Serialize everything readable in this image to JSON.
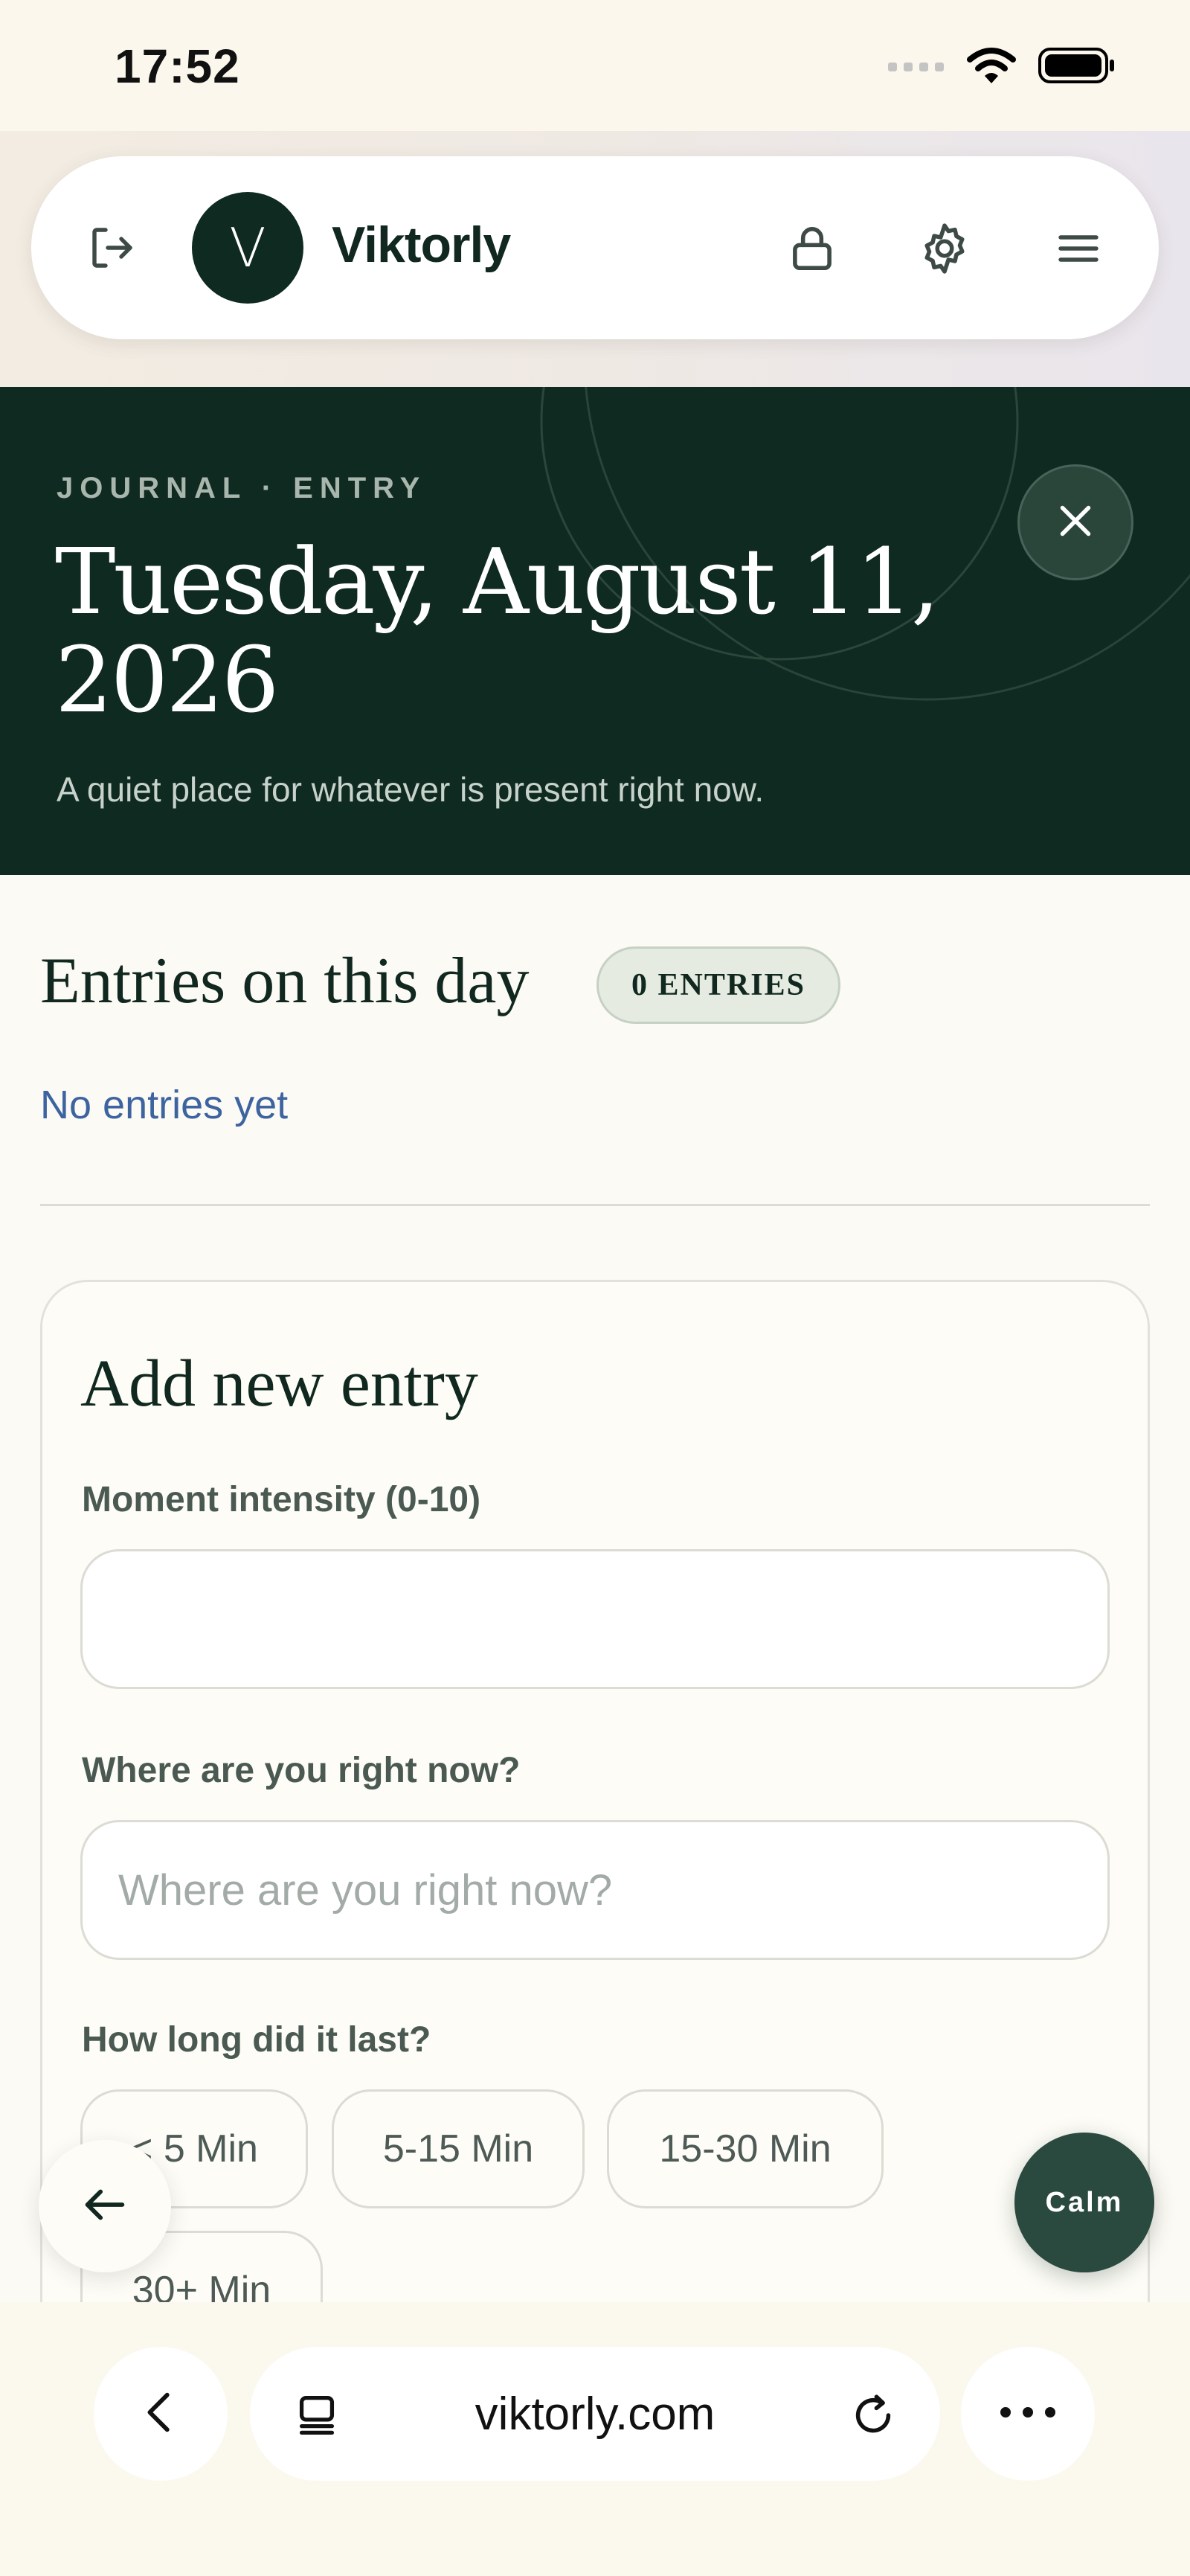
{
  "status_bar": {
    "time": "17:52",
    "icons": [
      "signal-icon",
      "wifi-icon",
      "battery-icon"
    ]
  },
  "nav": {
    "brand": "Viktorly",
    "logo_letter": "V",
    "icons": [
      "logout-icon",
      "lock-icon",
      "gear-icon",
      "menu-icon"
    ]
  },
  "hero": {
    "kicker": "JOURNAL · ENTRY",
    "title": "Tuesday, August 11, 2026",
    "subtitle": "A quiet place for whatever is present right now.",
    "close_icon": "close-icon"
  },
  "entries": {
    "heading": "Entries on this day",
    "count_badge": "0 ENTRIES",
    "empty_text": "No entries yet"
  },
  "form": {
    "title": "Add new entry",
    "intensity": {
      "label": "Moment intensity (0-10)",
      "value": "",
      "placeholder": ""
    },
    "location": {
      "label": "Where are you right now?",
      "value": "",
      "placeholder": "Where are you right now?"
    },
    "duration": {
      "label": "How long did it last?",
      "options": [
        "< 5 Min",
        "5-15 Min",
        "15-30 Min",
        "30+ Min"
      ]
    }
  },
  "floating": {
    "back_icon": "arrow-left-icon",
    "calm_label": "Calm"
  },
  "browser": {
    "url": "viktorly.com",
    "icons": [
      "chevron-left-icon",
      "tabs-icon",
      "reload-icon",
      "more-icon"
    ]
  },
  "colors": {
    "primary_dark": "#0f2a20",
    "calm_button": "#2b4a3f",
    "link_blue": "#3d64a0",
    "background": "#fcfaf4"
  }
}
